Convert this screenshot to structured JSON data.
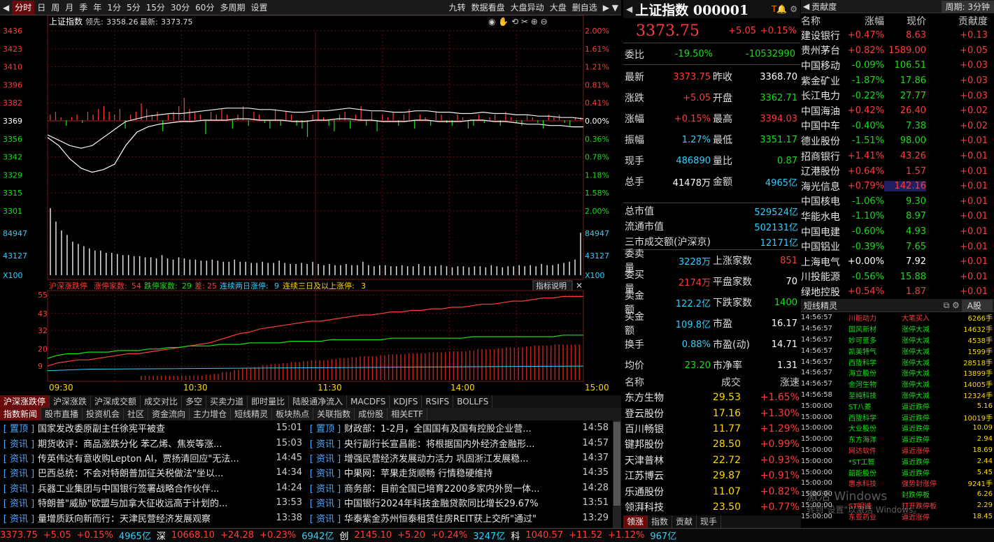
{
  "toolbar": {
    "items": [
      "分时",
      "日",
      "周",
      "月",
      "季",
      "年",
      "1分",
      "5分",
      "15分",
      "30分",
      "60分",
      "多周期",
      "设置"
    ],
    "right_items": [
      "九转",
      "数据看盘",
      "大盘异动",
      "大盘",
      "删自选"
    ]
  },
  "chart": {
    "header": {
      "name": "上证指数",
      "lead_label": "领先:",
      "lead_value": "3358.26",
      "last_label": "最新:",
      "last_value": "3373.75"
    },
    "price_ticks": [
      "3436",
      "3423",
      "3410",
      "3396",
      "3382",
      "3369",
      "3356",
      "3342",
      "3329",
      "3315",
      "3301"
    ],
    "pct_ticks": [
      "2.00%",
      "1.61%",
      "1.21%",
      "0.81%",
      "0.41%",
      "0.00%",
      "0.36%",
      "0.78%",
      "1.18%",
      "1.58%",
      "2.00%"
    ],
    "vol_ticks": [
      "84947",
      "43127",
      "X100"
    ],
    "line_white": [
      3356,
      3350,
      3340,
      3333,
      3330,
      3332,
      3336,
      3350,
      3360,
      3364,
      3366,
      3367,
      3368,
      3368,
      3369,
      3369,
      3369,
      3370,
      3370,
      3369,
      3369,
      3369,
      3368,
      3368,
      3369,
      3369,
      3370,
      3370,
      3369,
      3369,
      3368,
      3368,
      3368,
      3369,
      3369,
      3368,
      3368,
      3368,
      3369,
      3369,
      3368,
      3368,
      3367,
      3366,
      3366,
      3365,
      3365,
      3364,
      3364
    ],
    "line_yellow": [
      3358,
      3354,
      3350,
      3348,
      3350,
      3356,
      3362,
      3368,
      3370,
      3372,
      3373,
      3374,
      3374,
      3375,
      3376,
      3377,
      3378,
      3378,
      3378,
      3377,
      3377,
      3376,
      3375,
      3375,
      3376,
      3376,
      3377,
      3378,
      3377,
      3376,
      3376,
      3375,
      3375,
      3376,
      3376,
      3375,
      3375,
      3374,
      3374,
      3375,
      3374,
      3374,
      3373,
      3373,
      3372,
      3372,
      3371,
      3371,
      3370
    ],
    "bars": [
      2,
      3,
      1,
      -2,
      1,
      2,
      -1,
      3,
      2,
      4,
      5,
      3,
      2,
      4,
      -3,
      2,
      3,
      6,
      4,
      2,
      3,
      -4,
      2,
      3,
      5,
      8,
      4,
      3,
      2,
      -5,
      3,
      2,
      4,
      2,
      -3,
      2,
      5,
      -2,
      3,
      2,
      -1,
      -3,
      4,
      -2,
      3,
      2,
      -2,
      -3,
      -6,
      2,
      3,
      1,
      -2,
      -4,
      2,
      3,
      -3,
      2,
      5,
      -2,
      3,
      -4,
      2,
      1,
      3,
      -2,
      2,
      4,
      -3,
      2,
      1,
      -2,
      3,
      2,
      -1,
      -2,
      2,
      1,
      -3,
      -2,
      2,
      -1,
      1,
      2,
      -2,
      3,
      1,
      -1,
      -2,
      2,
      1,
      -1,
      -3,
      2,
      1,
      2,
      -1,
      -2,
      1,
      1
    ],
    "volume": [
      60,
      48,
      40,
      36,
      30,
      28,
      26,
      24,
      22,
      22,
      20,
      20,
      19,
      18,
      18,
      17,
      17,
      16,
      16,
      15,
      18,
      15,
      14,
      16,
      15,
      14,
      14,
      13,
      13,
      14,
      13,
      12,
      12,
      14,
      12,
      12,
      11,
      11,
      12,
      11,
      11,
      13,
      11,
      10,
      10,
      11,
      10,
      12,
      10,
      9,
      10,
      9,
      9,
      10,
      9,
      9,
      12,
      9,
      8,
      9,
      9,
      8,
      8,
      9,
      8,
      8,
      10,
      8,
      8,
      8,
      9,
      8,
      7,
      8,
      8,
      7,
      8,
      8,
      7,
      9,
      8,
      7,
      8,
      8,
      9,
      8,
      9,
      8,
      10,
      9,
      9,
      10,
      11,
      12,
      14,
      38
    ],
    "sub_header": {
      "title": "沪深涨跌停",
      "label1": "涨停家数:",
      "v1": "54",
      "label2": "跌停家数:",
      "v2": "29",
      "label3": "差:",
      "v3": "25",
      "label4": "连续两日涨停:",
      "v4": "9",
      "label5": "连续三日及以上涨停:",
      "v5": "3",
      "help": "指标说明"
    },
    "sub_ticks": [
      "55",
      "43",
      "32",
      "20",
      "9"
    ],
    "sub_red": [
      9,
      11,
      12,
      13,
      13,
      14,
      15,
      16,
      17,
      17,
      18,
      19,
      20,
      21,
      22,
      23,
      24,
      26,
      28,
      30,
      31,
      33,
      34,
      35,
      36,
      37,
      38,
      38,
      39,
      40,
      41,
      42,
      42,
      43,
      44,
      44,
      45,
      45,
      46,
      46,
      47,
      47,
      48,
      49,
      49,
      50,
      51,
      51,
      52,
      53,
      53,
      54,
      54,
      54
    ],
    "sub_green": [
      14,
      16,
      17,
      17,
      18,
      18,
      18,
      19,
      19,
      19,
      20,
      20,
      21,
      21,
      22,
      22,
      22,
      23,
      23,
      23,
      24,
      24,
      24,
      24,
      25,
      25,
      25,
      25,
      26,
      26,
      26,
      26,
      26,
      26,
      27,
      27,
      27,
      27,
      27,
      27,
      27,
      27,
      28,
      28,
      28,
      28,
      28,
      28,
      28,
      28,
      28,
      29,
      29,
      29
    ],
    "time_ticks": [
      "09:30",
      "10:30",
      "11:30",
      "14:00",
      "15:00"
    ]
  },
  "indicator_tabs": [
    "沪深涨跌停",
    "沪深涨跌",
    "沪深成交额",
    "成交对比",
    "多空",
    "买卖力道",
    "即时量比",
    "陆股通净流入",
    "MACDFS",
    "KDJFS",
    "RSIFS",
    "BOLLFS"
  ],
  "news_tabs": [
    "指数新闻",
    "股市直播",
    "投资机会",
    "社区",
    "资金流向",
    "主力增仓",
    "短线精灵",
    "板块热点",
    "关联指数",
    "成份股",
    "相关ETF"
  ],
  "news_left": [
    {
      "tag": "[ 置顶 ]",
      "text": "国家发改委原副主任徐宪平被查",
      "time": "15:01"
    },
    {
      "tag": "[ 资讯 ]",
      "text": "期货收评：商品涨跌分化 苯乙烯、焦炭等涨...",
      "time": "15:03"
    },
    {
      "tag": "[ 资讯 ]",
      "text": "传英伟达有意收购Lepton AI，贾扬清回应\"无法...",
      "time": "14:45"
    },
    {
      "tag": "[ 资讯 ]",
      "text": "巴西总统：不会对特朗普加征关税做法\"坐以...",
      "time": "14:34"
    },
    {
      "tag": "[ 资讯 ]",
      "text": "兵器工业集团与中国银行签署战略合作伙伴...",
      "time": "14:24"
    },
    {
      "tag": "[ 资讯 ]",
      "text": "特朗普\"威胁\"欧盟与加拿大征收远高于计划的...",
      "time": "13:53"
    },
    {
      "tag": "[ 资讯 ]",
      "text": "量增质跃向新而行：天津民营经济发展观察",
      "time": "13:38"
    }
  ],
  "news_right": [
    {
      "tag": "[ 置顶 ]",
      "text": "财政部：1-2月，全国国有及国有控股企业营...",
      "time": "14:58"
    },
    {
      "tag": "[ 资讯 ]",
      "text": "央行副行长宣昌能：将根据国内外经济金融形...",
      "time": "14:57"
    },
    {
      "tag": "[ 资讯 ]",
      "text": "增强民营经济发展动力活力 巩固浙江发展稳...",
      "time": "14:37"
    },
    {
      "tag": "[ 资讯 ]",
      "text": "中果网：苹果走货顺畅 行情稳硬维持",
      "time": "14:35"
    },
    {
      "tag": "[ 资讯 ]",
      "text": "商务部：目前全国已培育2200多家内外贸一体...",
      "time": "14:28"
    },
    {
      "tag": "[ 资讯 ]",
      "text": "中国银行2024年科技金融贷款同比增长29.67%",
      "time": "13:51"
    },
    {
      "tag": "[ 资讯 ]",
      "text": "华泰紫金苏州恒泰租赁住房REIT获上交所\"通过\"",
      "time": "13:29"
    }
  ],
  "quote": {
    "title": "上证指数 000001",
    "price": "3373.75",
    "change": "+5.05",
    "change_pct": "+0.15%",
    "weibi_label": "委比",
    "weibi_pct": "-19.50%",
    "weibi_val": "-10532990",
    "rows": [
      {
        "l1": "最新",
        "v1": "3373.75",
        "c1": "red",
        "l2": "昨收",
        "v2": "3368.70",
        "c2": "white"
      },
      {
        "l1": "涨跌",
        "v1": "+5.05",
        "c1": "red",
        "l2": "开盘",
        "v2": "3362.71",
        "c2": "green"
      },
      {
        "l1": "涨幅",
        "v1": "+0.15%",
        "c1": "red",
        "l2": "最高",
        "v2": "3394.03",
        "c2": "red"
      },
      {
        "l1": "振幅",
        "v1": "1.27%",
        "c1": "cyan",
        "l2": "最低",
        "v2": "3351.17",
        "c2": "green"
      },
      {
        "l1": "现手",
        "v1": "486890",
        "c1": "cyan",
        "l2": "量比",
        "v2": "0.87",
        "c2": "green"
      },
      {
        "l1": "总手",
        "v1": "41478万",
        "c1": "white",
        "l2": "金额",
        "v2": "4965亿",
        "c2": "cyan"
      }
    ],
    "mkt": [
      {
        "l": "总市值",
        "v": "529524亿"
      },
      {
        "l": "流通市值",
        "v": "502131亿"
      },
      {
        "l": "三市成交额(沪深京)",
        "v": "12171亿"
      }
    ],
    "rows2": [
      {
        "l1": "委卖量",
        "v1": "3228万",
        "c1": "cyan",
        "l2": "上涨家数",
        "v2": "851",
        "c2": "red"
      },
      {
        "l1": "委买量",
        "v1": "2174万",
        "c1": "red",
        "l2": "平盘家数",
        "v2": "70",
        "c2": "white"
      },
      {
        "l1": "卖金额",
        "v1": "122.2亿",
        "c1": "cyan",
        "l2": "下跌家数",
        "v2": "1400",
        "c2": "green"
      },
      {
        "l1": "买金额",
        "v1": "109.8亿",
        "c1": "cyan",
        "l2": "市盈",
        "v2": "16.17",
        "c2": "white"
      },
      {
        "l1": "换手",
        "v1": "0.88%",
        "c1": "cyan",
        "l2": "市盈(动)",
        "v2": "14.71",
        "c2": "white"
      },
      {
        "l1": "均价",
        "v1": "23.20",
        "c1": "green",
        "l2": "市净率",
        "v2": "1.31",
        "c2": "white"
      }
    ]
  },
  "leaders": {
    "headers": [
      "名称",
      "成交",
      "涨速"
    ],
    "rows": [
      {
        "n": "东方生物",
        "a": "29.53",
        "b": "+1.65%"
      },
      {
        "n": "登云股份",
        "a": "17.16",
        "b": "+1.30%"
      },
      {
        "n": "百川畅银",
        "a": "11.77",
        "b": "+1.29%"
      },
      {
        "n": "键邦股份",
        "a": "28.50",
        "b": "+0.99%"
      },
      {
        "n": "天津普林",
        "a": "22.72",
        "b": "+0.93%"
      },
      {
        "n": "江苏博云",
        "a": "29.87",
        "b": "+0.91%"
      },
      {
        "n": "乐通股份",
        "a": "11.07",
        "b": "+0.82%"
      },
      {
        "n": "领湃科技",
        "a": "23.50",
        "b": "+0.77%"
      }
    ],
    "tabs": [
      "领涨",
      "指数",
      "贡献",
      "现手"
    ]
  },
  "contrib": {
    "title": "贡献度",
    "period": "周期: 3分钟",
    "headers": [
      "名称",
      "涨幅",
      "现价",
      "贡献度"
    ],
    "rows": [
      {
        "n": "建设银行",
        "p": "+0.47%",
        "x": "8.63",
        "c": "+0.13",
        "pc": "red"
      },
      {
        "n": "贵州茅台",
        "p": "+0.82%",
        "x": "1589.00",
        "c": "+0.05",
        "pc": "red"
      },
      {
        "n": "中国移动",
        "p": "-0.09%",
        "x": "106.51",
        "c": "+0.03",
        "pc": "green"
      },
      {
        "n": "紫金矿业",
        "p": "-1.87%",
        "x": "17.86",
        "c": "+0.03",
        "pc": "green"
      },
      {
        "n": "长江电力",
        "p": "-0.22%",
        "x": "27.77",
        "c": "+0.03",
        "pc": "green"
      },
      {
        "n": "中国海油",
        "p": "+0.42%",
        "x": "26.40",
        "c": "+0.02",
        "pc": "red"
      },
      {
        "n": "中国中车",
        "p": "-0.40%",
        "x": "7.38",
        "c": "+0.02",
        "pc": "green"
      },
      {
        "n": "德业股份",
        "p": "-1.51%",
        "x": "98.00",
        "c": "+0.01",
        "pc": "green"
      },
      {
        "n": "招商银行",
        "p": "+1.41%",
        "x": "43.26",
        "c": "+0.01",
        "pc": "red"
      },
      {
        "n": "辽港股份",
        "p": "+0.64%",
        "x": "1.57",
        "c": "+0.01",
        "pc": "red"
      },
      {
        "n": "海光信息",
        "p": "+0.79%",
        "x": "142.16",
        "c": "+0.01",
        "pc": "red"
      },
      {
        "n": "中国核电",
        "p": "-1.06%",
        "x": "9.30",
        "c": "+0.01",
        "pc": "green"
      },
      {
        "n": "华能水电",
        "p": "-1.10%",
        "x": "8.97",
        "c": "+0.01",
        "pc": "green"
      },
      {
        "n": "中国电建",
        "p": "-0.60%",
        "x": "4.93",
        "c": "+0.01",
        "pc": "green"
      },
      {
        "n": "中国铝业",
        "p": "-0.39%",
        "x": "7.65",
        "c": "+0.01",
        "pc": "green"
      },
      {
        "n": "上海电气",
        "p": "+0.00%",
        "x": "7.92",
        "c": "+0.01",
        "pc": "white"
      },
      {
        "n": "川投能源",
        "p": "-0.56%",
        "x": "15.88",
        "c": "+0.01",
        "pc": "green"
      },
      {
        "n": "绿地控股",
        "p": "+0.54%",
        "x": "1.87",
        "c": "+0.01",
        "pc": "red"
      }
    ]
  },
  "ticker": {
    "title": "短线精灵",
    "market": "A股",
    "rows": [
      {
        "t": "14:56:57",
        "s": "川能动力",
        "k": "大笔买入",
        "v": "6266手",
        "kc": "red"
      },
      {
        "t": "14:56:57",
        "s": "国风新材",
        "k": "涨停大减",
        "v": "14632手",
        "kc": "green"
      },
      {
        "t": "14:56:57",
        "s": "妙可蓝多",
        "k": "涨停大减",
        "v": "4538手",
        "kc": "green"
      },
      {
        "t": "14:56:57",
        "s": "凯美特气",
        "k": "涨停大减",
        "v": "1599手",
        "kc": "green"
      },
      {
        "t": "14:56:57",
        "s": "西陇科学",
        "k": "涨停大减",
        "v": "28518手",
        "kc": "green"
      },
      {
        "t": "14:56:57",
        "s": "海立股份",
        "k": "涨停大减",
        "v": "13899手",
        "kc": "green"
      },
      {
        "t": "14:56:57",
        "s": "金河生物",
        "k": "涨停大减",
        "v": "14005手",
        "kc": "green"
      },
      {
        "t": "14:56:58",
        "s": "至纯科技",
        "k": "涨停大减",
        "v": "12324手",
        "kc": "green"
      },
      {
        "t": "15:00:00",
        "s": "ST八菱",
        "k": "逼近跌停",
        "v": "5.16",
        "kc": "green"
      },
      {
        "t": "15:00:00",
        "s": "西陇科学",
        "k": "逼近跌停",
        "v": "10019手",
        "kc": "green"
      },
      {
        "t": "15:00:00",
        "s": "大业股份",
        "k": "逼近跌停",
        "v": "10.09",
        "kc": "green"
      },
      {
        "t": "15:00:00",
        "s": "东方海洋",
        "k": "逼近跌停",
        "v": "2.94",
        "kc": "green"
      },
      {
        "t": "15:00:00",
        "s": "网达软件",
        "k": "逼近涨停",
        "v": "18.69",
        "kc": "red"
      },
      {
        "t": "15:00:00",
        "s": "*ST工智",
        "k": "逼近跌停",
        "v": "2.44",
        "kc": "green"
      },
      {
        "t": "15:00:00",
        "s": "韶能股份",
        "k": "逼近跌停",
        "v": "5.45",
        "kc": "green"
      },
      {
        "t": "15:00:00",
        "s": "惠水科技",
        "k": "强势封涨停",
        "v": "9241手",
        "kc": "red"
      },
      {
        "t": "15:00:00",
        "s": "",
        "k": "封跌停板",
        "v": "6.26",
        "kc": "green"
      },
      {
        "t": "15:00:00",
        "s": "ST明诚",
        "k": "打开跌停板",
        "v": "2.29",
        "kc": "red"
      },
      {
        "t": "15:00:00",
        "s": "东亚药业",
        "k": "逼近涨停",
        "v": "18.45",
        "kc": "red"
      }
    ]
  },
  "watermark": {
    "line1": "激活 Windows",
    "line2": "转到\"设置\"以激活 Windows。"
  },
  "status": [
    {
      "v": "3373.75",
      "c": "red"
    },
    {
      "v": "+5.05",
      "c": "red"
    },
    {
      "v": "+0.15%",
      "c": "red"
    },
    {
      "v": "4965亿",
      "c": "cyan"
    },
    {
      "v": "深",
      "c": "white"
    },
    {
      "v": "10668.10",
      "c": "red"
    },
    {
      "v": "+24.28",
      "c": "red"
    },
    {
      "v": "+0.23%",
      "c": "red"
    },
    {
      "v": "6942亿",
      "c": "cyan"
    },
    {
      "v": "创",
      "c": "white"
    },
    {
      "v": "2145.10",
      "c": "red"
    },
    {
      "v": "+5.20",
      "c": "red"
    },
    {
      "v": "+0.24%",
      "c": "red"
    },
    {
      "v": "3247亿",
      "c": "cyan"
    },
    {
      "v": "科",
      "c": "white"
    },
    {
      "v": "1040.57",
      "c": "red"
    },
    {
      "v": "+11.52",
      "c": "red"
    },
    {
      "v": "+1.12%",
      "c": "red"
    },
    {
      "v": "967亿",
      "c": "cyan"
    }
  ]
}
